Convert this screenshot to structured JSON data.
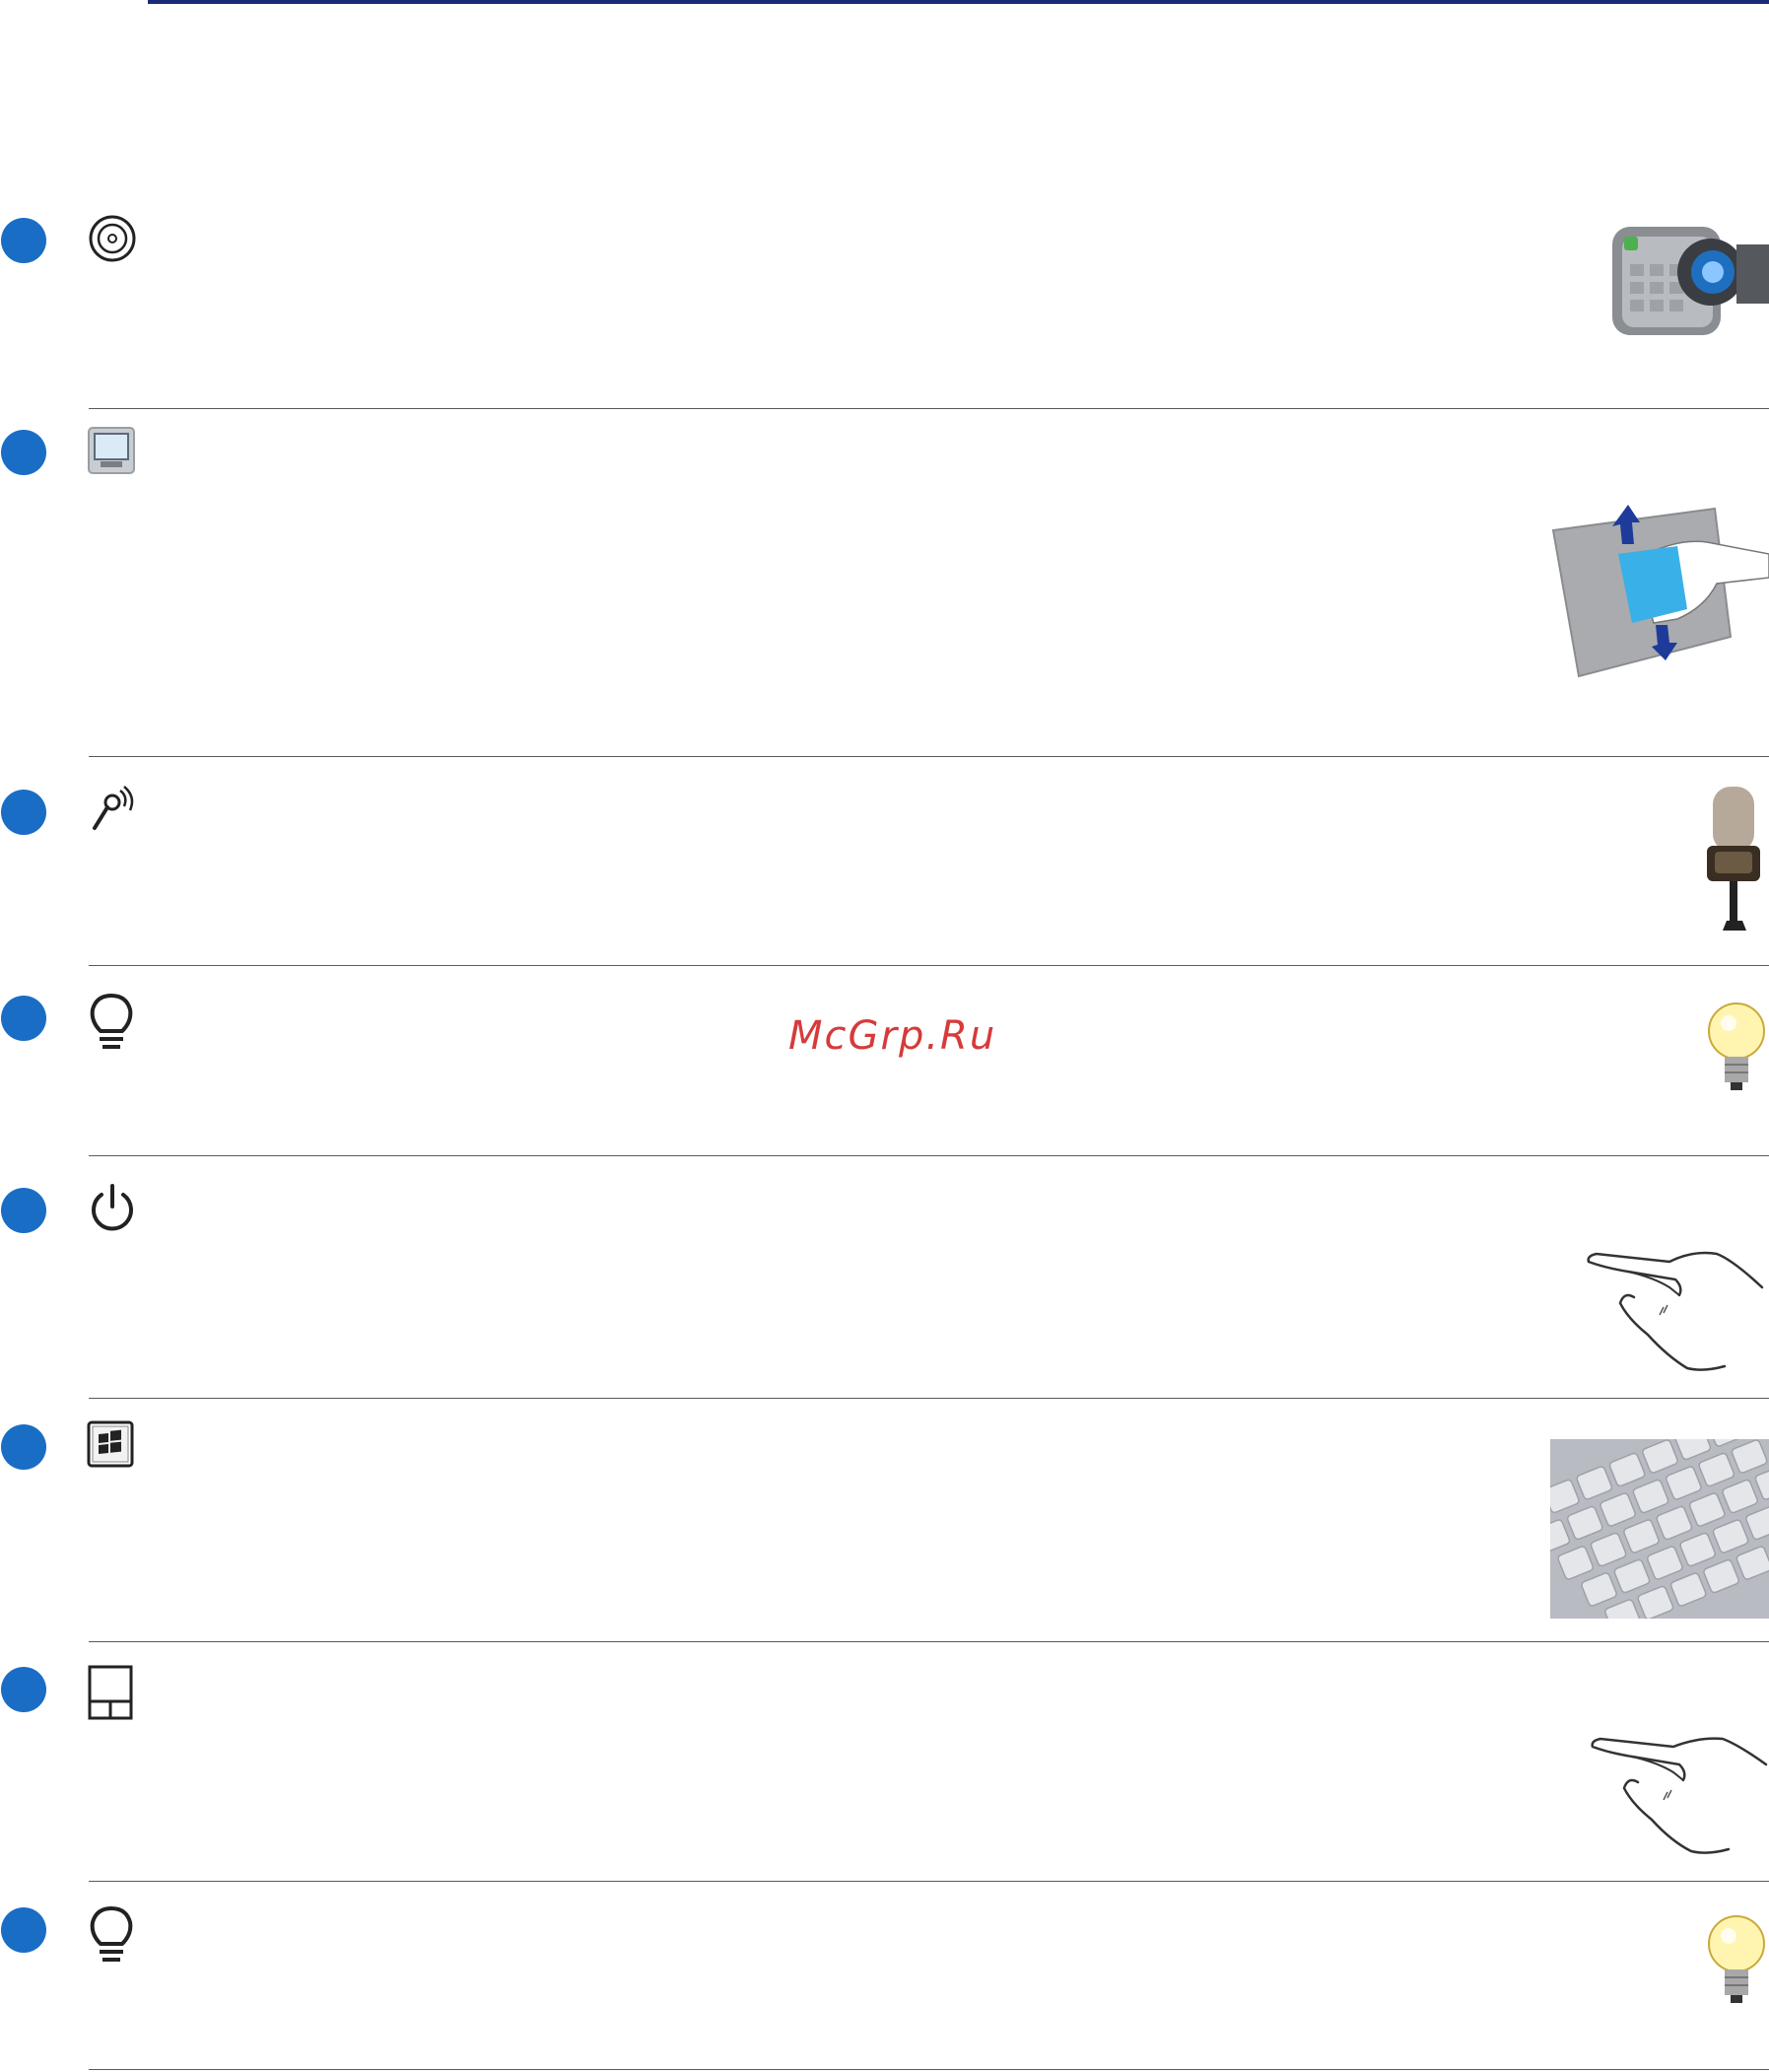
{
  "watermark": "McGrp.Ru",
  "colors": {
    "bullet": "#1a6dc4",
    "top_rule": "#1b2a78",
    "watermark": "#d63a3a"
  },
  "items": [
    {
      "icon": "camera-lens-icon",
      "illustration": "camcorder-illustration"
    },
    {
      "icon": "display-panel-icon",
      "illustration": "screen-cleaning-illustration"
    },
    {
      "icon": "microphone-icon",
      "illustration": "studio-microphone-illustration"
    },
    {
      "icon": "indicator-lightbulb-icon",
      "illustration": "lightbulb-illustration"
    },
    {
      "icon": "power-icon",
      "illustration": "finger-press-illustration"
    },
    {
      "icon": "windows-key-icon",
      "illustration": "keyboard-illustration"
    },
    {
      "icon": "touchpad-icon",
      "illustration": "finger-touchpad-illustration"
    },
    {
      "icon": "status-lightbulb-icon",
      "illustration": "lightbulb-illustration"
    }
  ]
}
